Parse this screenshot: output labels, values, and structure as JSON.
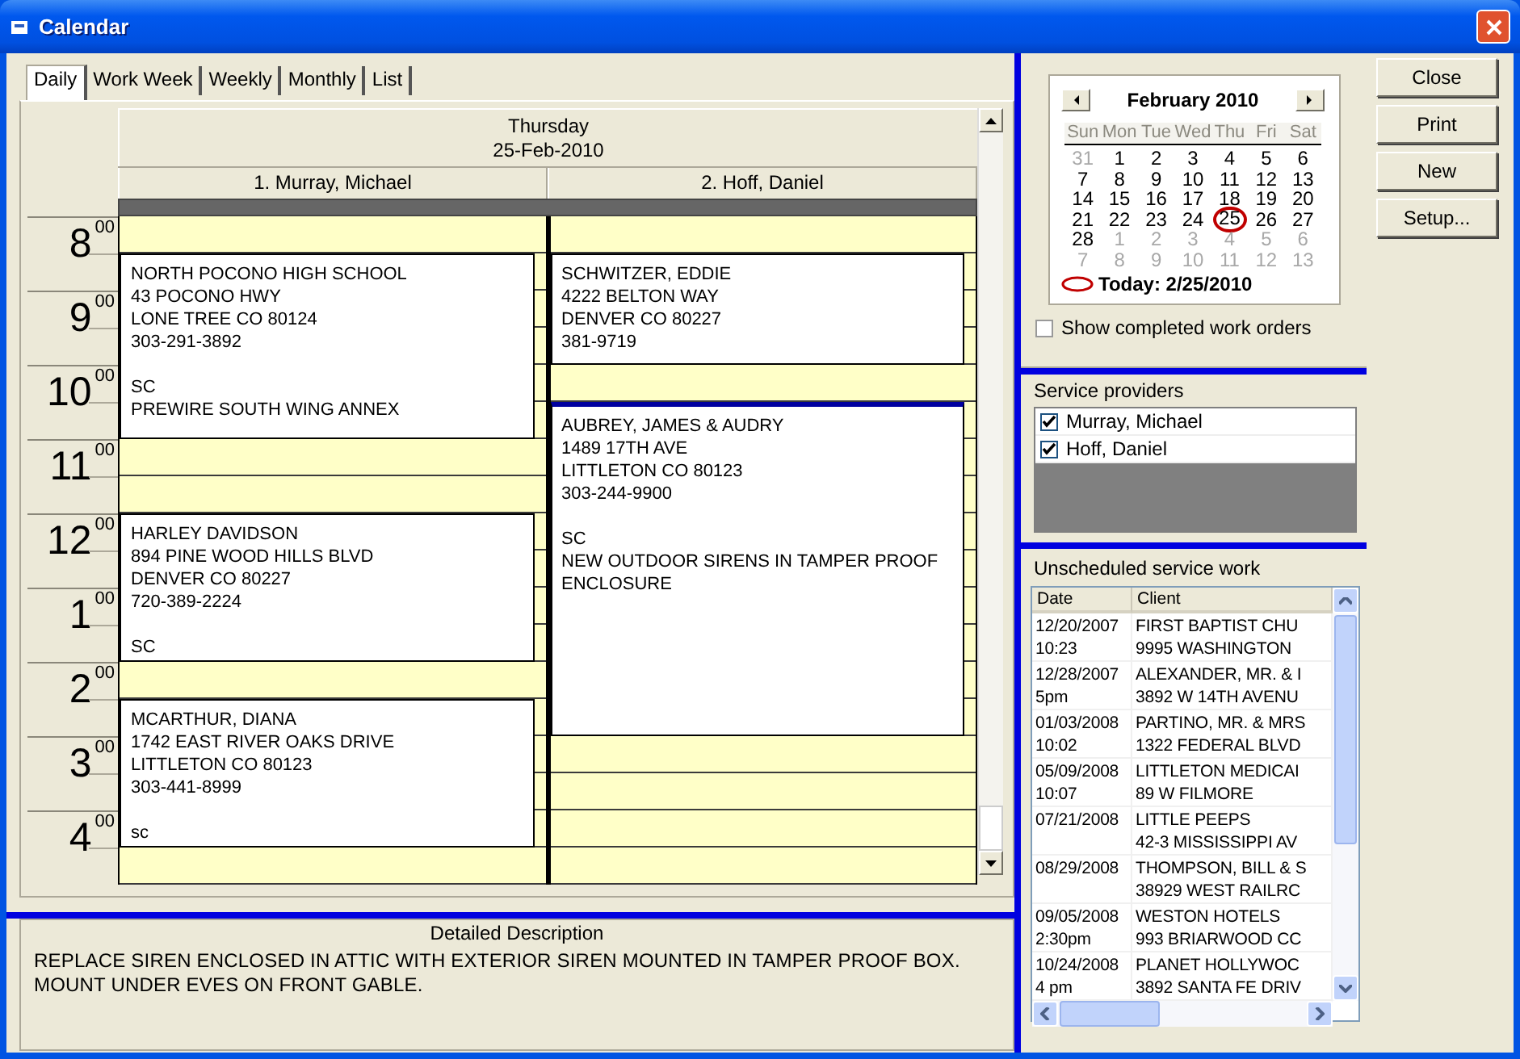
{
  "window": {
    "title": "Calendar"
  },
  "tabs": [
    {
      "label": "Daily",
      "selected": true
    },
    {
      "label": "Work Week",
      "selected": false
    },
    {
      "label": "Weekly",
      "selected": false
    },
    {
      "label": "Monthly",
      "selected": false
    },
    {
      "label": "List",
      "selected": false
    }
  ],
  "day_view": {
    "weekday": "Thursday",
    "date": "25-Feb-2010",
    "hours": [
      {
        "hour": "8",
        "minutes": "00"
      },
      {
        "hour": "9",
        "minutes": "00"
      },
      {
        "hour": "10",
        "minutes": "00"
      },
      {
        "hour": "11",
        "minutes": "00"
      },
      {
        "hour": "12",
        "minutes": "00"
      },
      {
        "hour": "1",
        "minutes": "00"
      },
      {
        "hour": "2",
        "minutes": "00"
      },
      {
        "hour": "3",
        "minutes": "00"
      },
      {
        "hour": "4",
        "minutes": "00"
      }
    ],
    "columns": [
      {
        "name": "1. Murray, Michael",
        "appointments": [
          {
            "selected": false,
            "lines": [
              "NORTH POCONO HIGH SCHOOL",
              "43 POCONO HWY",
              "LONE TREE CO 80124",
              "303-291-3892"
            ],
            "notes": [
              "SC",
              "PREWIRE SOUTH WING ANNEX"
            ]
          },
          {
            "selected": false,
            "lines": [
              "HARLEY DAVIDSON",
              "894 PINE WOOD HILLS BLVD",
              "DENVER CO 80227",
              "720-389-2224"
            ],
            "notes": [
              "SC"
            ]
          },
          {
            "selected": false,
            "lines": [
              "MCARTHUR, DIANA",
              "1742 EAST RIVER OAKS DRIVE",
              "LITTLETON CO 80123",
              "303-441-8999"
            ],
            "notes": [
              "sc"
            ]
          }
        ]
      },
      {
        "name": "2. Hoff, Daniel",
        "appointments": [
          {
            "selected": false,
            "lines": [
              "SCHWITZER, EDDIE",
              "4222 BELTON WAY",
              "DENVER CO 80227",
              "381-9719"
            ]
          },
          {
            "selected": true,
            "lines": [
              "AUBREY, JAMES & AUDRY",
              "1489 17TH AVE",
              "LITTLETON CO 80123",
              "303-244-9900"
            ],
            "notes": [
              "SC",
              "NEW OUTDOOR SIRENS IN TAMPER PROOF ENCLOSURE"
            ]
          }
        ]
      }
    ]
  },
  "description": {
    "title": "Detailed Description",
    "text": "REPLACE SIREN ENCLOSED IN ATTIC WITH EXTERIOR SIREN MOUNTED IN TAMPER PROOF BOX.  MOUNT UNDER EVES ON FRONT GABLE."
  },
  "mini_calendar": {
    "month": "February 2010",
    "weekdays": [
      "Sun",
      "Mon",
      "Tue",
      "Wed",
      "Thu",
      "Fri",
      "Sat"
    ],
    "weeks": [
      [
        {
          "day": "31",
          "muted": true,
          "selected": false
        },
        {
          "day": "1",
          "muted": false,
          "selected": false
        },
        {
          "day": "2",
          "muted": false,
          "selected": false
        },
        {
          "day": "3",
          "muted": false,
          "selected": false
        },
        {
          "day": "4",
          "muted": false,
          "selected": false
        },
        {
          "day": "5",
          "muted": false,
          "selected": false
        },
        {
          "day": "6",
          "muted": false,
          "selected": false
        }
      ],
      [
        {
          "day": "7",
          "muted": false,
          "selected": false
        },
        {
          "day": "8",
          "muted": false,
          "selected": false
        },
        {
          "day": "9",
          "muted": false,
          "selected": false
        },
        {
          "day": "10",
          "muted": false,
          "selected": false
        },
        {
          "day": "11",
          "muted": false,
          "selected": false
        },
        {
          "day": "12",
          "muted": false,
          "selected": false
        },
        {
          "day": "13",
          "muted": false,
          "selected": false
        }
      ],
      [
        {
          "day": "14",
          "muted": false,
          "selected": false
        },
        {
          "day": "15",
          "muted": false,
          "selected": false
        },
        {
          "day": "16",
          "muted": false,
          "selected": false
        },
        {
          "day": "17",
          "muted": false,
          "selected": false
        },
        {
          "day": "18",
          "muted": false,
          "selected": false
        },
        {
          "day": "19",
          "muted": false,
          "selected": false
        },
        {
          "day": "20",
          "muted": false,
          "selected": false
        }
      ],
      [
        {
          "day": "21",
          "muted": false,
          "selected": false
        },
        {
          "day": "22",
          "muted": false,
          "selected": false
        },
        {
          "day": "23",
          "muted": false,
          "selected": false
        },
        {
          "day": "24",
          "muted": false,
          "selected": false
        },
        {
          "day": "25",
          "muted": false,
          "selected": true
        },
        {
          "day": "26",
          "muted": false,
          "selected": false
        },
        {
          "day": "27",
          "muted": false,
          "selected": false
        }
      ],
      [
        {
          "day": "28",
          "muted": false,
          "selected": false
        },
        {
          "day": "1",
          "muted": true,
          "selected": false
        },
        {
          "day": "2",
          "muted": true,
          "selected": false
        },
        {
          "day": "3",
          "muted": true,
          "selected": false
        },
        {
          "day": "4",
          "muted": true,
          "selected": false
        },
        {
          "day": "5",
          "muted": true,
          "selected": false
        },
        {
          "day": "6",
          "muted": true,
          "selected": false
        }
      ],
      [
        {
          "day": "7",
          "muted": true,
          "selected": false
        },
        {
          "day": "8",
          "muted": true,
          "selected": false
        },
        {
          "day": "9",
          "muted": true,
          "selected": false
        },
        {
          "day": "10",
          "muted": true,
          "selected": false
        },
        {
          "day": "11",
          "muted": true,
          "selected": false
        },
        {
          "day": "12",
          "muted": true,
          "selected": false
        },
        {
          "day": "13",
          "muted": true,
          "selected": false
        }
      ]
    ],
    "today": "Today: 2/25/2010"
  },
  "show_completed": {
    "label": "Show completed work orders",
    "checked": false
  },
  "service_providers": {
    "title": "Service providers",
    "items": [
      {
        "name": "Murray, Michael",
        "checked": true
      },
      {
        "name": "Hoff, Daniel",
        "checked": true
      }
    ]
  },
  "unscheduled": {
    "title": "Unscheduled service work",
    "columns": [
      "Date",
      "Client"
    ],
    "rows": [
      {
        "date": "12/20/2007",
        "time": "10:23",
        "client": "FIRST BAPTIST CHU",
        "address": "9995 WASHINGTON"
      },
      {
        "date": "12/28/2007",
        "time": "5pm",
        "client": "ALEXANDER, MR. & I",
        "address": "3892 W 14TH AVENU"
      },
      {
        "date": "01/03/2008",
        "time": "10:02",
        "client": "PARTINO, MR. & MRS",
        "address": "1322 FEDERAL BLVD"
      },
      {
        "date": "05/09/2008",
        "time": "10:07",
        "client": "LITTLETON MEDICAI",
        "address": "89 W FILMORE"
      },
      {
        "date": "07/21/2008",
        "client": "LITTLE PEEPS",
        "address": "42-3 MISSISSIPPI AV"
      },
      {
        "date": "08/29/2008",
        "client": "THOMPSON, BILL & S",
        "address": "38929 WEST RAILRC"
      },
      {
        "date": "09/05/2008",
        "time": "2:30pm",
        "client": "WESTON HOTELS",
        "address": "993 BRIARWOOD CC"
      },
      {
        "date": "10/24/2008",
        "time": "4 pm",
        "client": "PLANET HOLLYWOC",
        "address": "3892 SANTA FE DRIV"
      }
    ]
  },
  "buttons": [
    "Close",
    "Print",
    "New",
    "Setup..."
  ]
}
